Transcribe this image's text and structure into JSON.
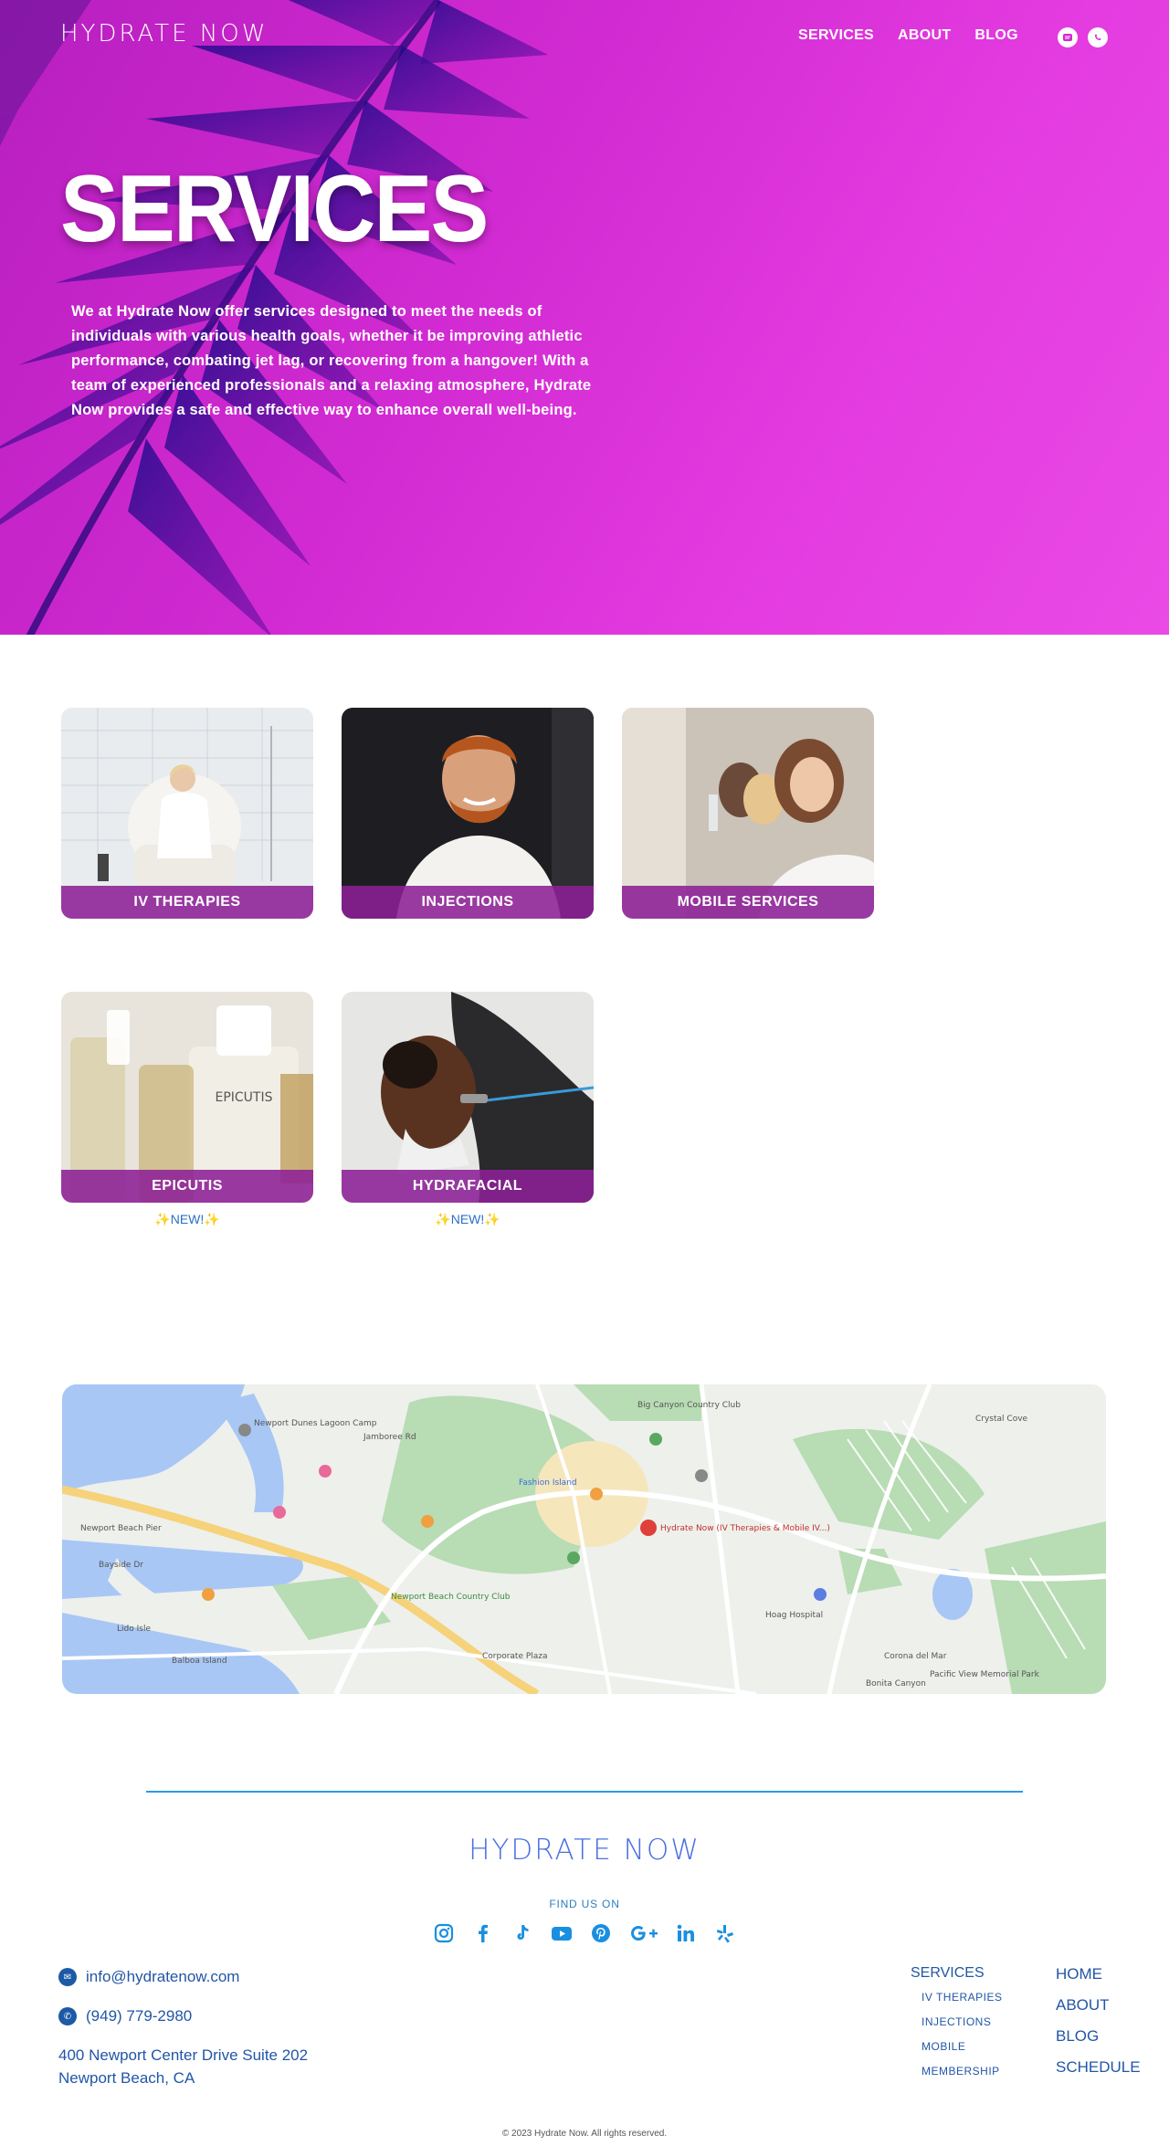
{
  "header": {
    "logo_text": "HYDRATE NOW",
    "nav": [
      "SERVICES",
      "ABOUT",
      "BLOG"
    ],
    "icons": [
      "message-icon",
      "whatsapp-icon"
    ]
  },
  "hero": {
    "title": "SERVICES",
    "body": "We at Hydrate Now offer services designed to meet the needs of individuals with various health goals, whether it be improving athletic performance, combating jet lag, or recovering from a hangover! With a team of experienced professionals and a relaxing atmosphere, Hydrate Now provides a safe and effective way to enhance overall well-being."
  },
  "services": [
    {
      "label": "IV THERAPIES"
    },
    {
      "label": "INJECTIONS"
    },
    {
      "label": "MOBILE SERVICES"
    },
    {
      "label": "EPICUTIS",
      "tag": "✨NEW!✨"
    },
    {
      "label": "HYDRAFACIAL",
      "tag": "✨NEW!✨"
    }
  ],
  "map": {
    "labels": [
      "Big Canyon Country Club",
      "Newport Dunes Lagoon Camp",
      "Fashion Island",
      "Hydrate Now (IV Therapies & Mobile IV...)",
      "Newport Beach Country Club",
      "Balboa Island",
      "Corona del Mar",
      "Crystal Cove",
      "Newport Beach Pier",
      "Lido Isle",
      "Bayside Dr",
      "Jamboree Rd",
      "Pacific View Memorial Park",
      "Hoag Hospital",
      "Corporate Plaza",
      "Bonita Canyon"
    ]
  },
  "footer": {
    "logo_text": "HYDRATE NOW",
    "find_us": "FIND US ON",
    "socials": [
      "instagram-icon",
      "facebook-icon",
      "tiktok-icon",
      "youtube-icon",
      "pinterest-icon",
      "google-plus-icon",
      "linkedin-icon",
      "yelp-icon"
    ],
    "email": "info@hydratenow.com",
    "phone": "(949) 779-2980",
    "address_line1": "400 Newport Center Drive Suite 202",
    "address_line2": "Newport Beach, CA",
    "services_heading": "SERVICES",
    "services_links": [
      "IV THERAPIES",
      "INJECTIONS",
      "MOBILE",
      "MEMBERSHIP"
    ],
    "links": [
      "HOME",
      "ABOUT",
      "BLOG",
      "SCHEDULE"
    ],
    "copyright": "© 2023 Hydrate Now. All rights reserved."
  },
  "colors": {
    "hero_magenta": "#d12ad2",
    "card_bar": "#8c2096",
    "footer_blue": "#2256a6",
    "accent_blue": "#2b9be0"
  }
}
